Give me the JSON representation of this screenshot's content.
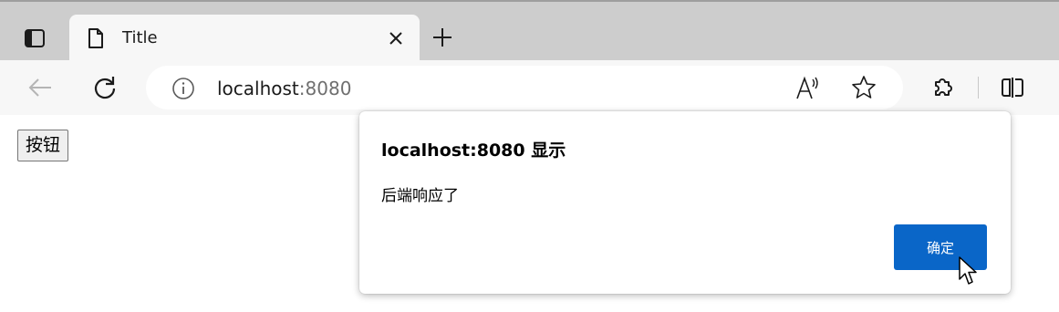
{
  "tab": {
    "title": "Title"
  },
  "address": {
    "host": "localhost",
    "port": ":8080"
  },
  "page": {
    "button_label": "按钮"
  },
  "dialog": {
    "title": "localhost:8080 显示",
    "message": "后端响应了",
    "ok_label": "确定"
  },
  "colors": {
    "tab_strip": "#cdcdcd",
    "toolbar": "#f7f7f7",
    "ok_button": "#0a66c8"
  },
  "icons": {
    "tab_actions": "tab-actions-icon",
    "page": "page-icon",
    "close": "close-icon",
    "new_tab": "plus-icon",
    "back": "back-arrow-icon",
    "refresh": "refresh-icon",
    "info": "info-icon",
    "read_aloud": "read-aloud-icon",
    "favorite": "star-icon",
    "extensions": "extensions-icon",
    "split_screen": "split-screen-icon"
  }
}
